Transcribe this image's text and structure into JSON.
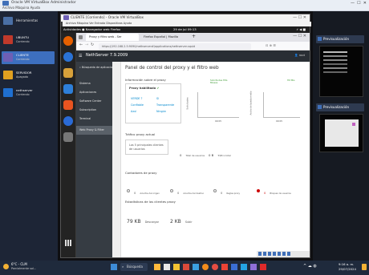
{
  "host": {
    "title": "Oracle VM VirtualBox Administrador",
    "menu": "Archivo  Máquina  Ayuda",
    "tools_label": "Herramientas"
  },
  "vm_list": [
    {
      "name": "UBUNTU",
      "state": "Corriendo",
      "thumb_color": "#c0392b"
    },
    {
      "name": "CLIENTE",
      "state": "Corriendo",
      "thumb_color": "#6e5fb5"
    },
    {
      "name": "SERVIDOR",
      "state": "Apagada",
      "thumb_color": "#e0a020"
    },
    {
      "name": "nethserver",
      "state": "Corriendo",
      "thumb_color": "#1f6fd0"
    }
  ],
  "right_panels": [
    {
      "label": "Previsualización"
    },
    {
      "label": "Previsualización"
    }
  ],
  "vm_window": {
    "title": "CLIENTE [Corriendo] - Oracle VM VirtualBox",
    "menu": "Archivo  Máquina  Ver  Entrada  Dispositivos  Ayuda",
    "controls": "—  ☐  ✕"
  },
  "gnome": {
    "activities": "Actividades   ● Navegador web Firefox",
    "clock": "29 de jul  09:13",
    "status": "⚡ ◀ ■"
  },
  "firefox": {
    "tab1": "Proxy y filtro web - Ser",
    "tab2": "Firefox Español | Mozilla",
    "url": "https://192.168.2.5:9090/nethserver#/applications/nethserver-squid"
  },
  "nethserver": {
    "brand": "NethServer 7.9.2009",
    "user": "root",
    "sidebar": [
      {
        "label": "Búsqueda de aplicaciones"
      },
      {
        "label": "Sistema"
      },
      {
        "label": "Aplicaciones"
      },
      {
        "label": "Software Center"
      },
      {
        "label": "Subscription"
      },
      {
        "label": "Terminal"
      },
      {
        "label": "Web Proxy & Filter"
      }
    ],
    "page_title": "Panel de control del proxy y el filtro web",
    "proxy_info_title": "Información sobre el proxy",
    "proxy_enabled_label": "Proxy habilitado",
    "zones": [
      {
        "name": "VERDE ?",
        "value": "Sí"
      },
      {
        "name": "Confiable",
        "value": "Transparente"
      },
      {
        "name": "Azul",
        "value": "Ningún"
      }
    ],
    "chart1": {
      "legend": "Solicitudes Hits Misses",
      "ylabel": "Solicitudes",
      "x": "09:05"
    },
    "chart2": {
      "legend": "Hit Mis",
      "ylabel": "Ancho de banda medio",
      "x": "09:05"
    },
    "filter_title": "Tráfico proxy actual",
    "filter_desc": "Los 5 principales clientes de usuarios",
    "filter_stats": [
      {
        "value": "0",
        "label": "Total de usuarios"
      },
      {
        "value": "0 B",
        "label": "Tráfico total"
      }
    ],
    "counters_title": "Contadores de proxy",
    "counters": [
      {
        "value": "0",
        "label": "Aciertos del origen"
      },
      {
        "value": "0",
        "label": "Aciertos del destino"
      },
      {
        "value": "0",
        "label": "Reglas proxy"
      },
      {
        "value": "0",
        "label": "Bloqueo de usuarios"
      }
    ],
    "clients_title": "Estadísticas de los clientes proxy",
    "download_label": "Descargar",
    "download_value": "79 KB",
    "upload_label": "Subir",
    "upload_value": "2 KB"
  },
  "taskbar": {
    "weather_temp": "6°C - CLM",
    "weather_desc": "Parcialmente sol...",
    "search": "Búsqueda",
    "time": "9:16 a. m.",
    "date": "29/07/2024"
  }
}
